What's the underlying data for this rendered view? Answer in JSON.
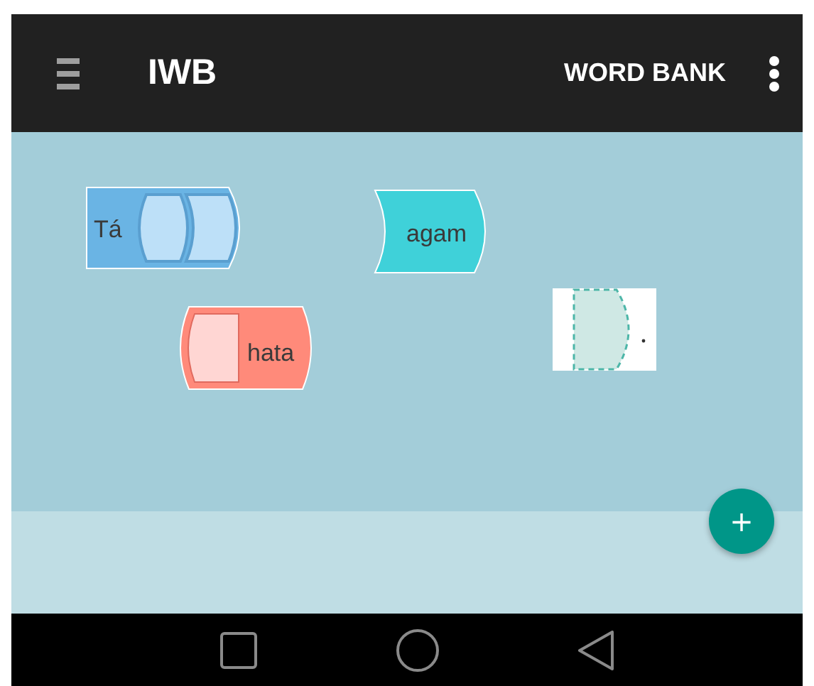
{
  "app_bar": {
    "title": "IWB",
    "action": "WORD BANK"
  },
  "blocks": [
    {
      "kind": "prefix",
      "text": "Tá",
      "color": "#6ab4e4"
    },
    {
      "kind": "word",
      "text": "agam",
      "color": "#3fd1d9"
    },
    {
      "kind": "suffix",
      "text": "hata",
      "color": "#ff8a7a"
    },
    {
      "kind": "placeholder"
    }
  ],
  "fab": {
    "label": "+"
  }
}
